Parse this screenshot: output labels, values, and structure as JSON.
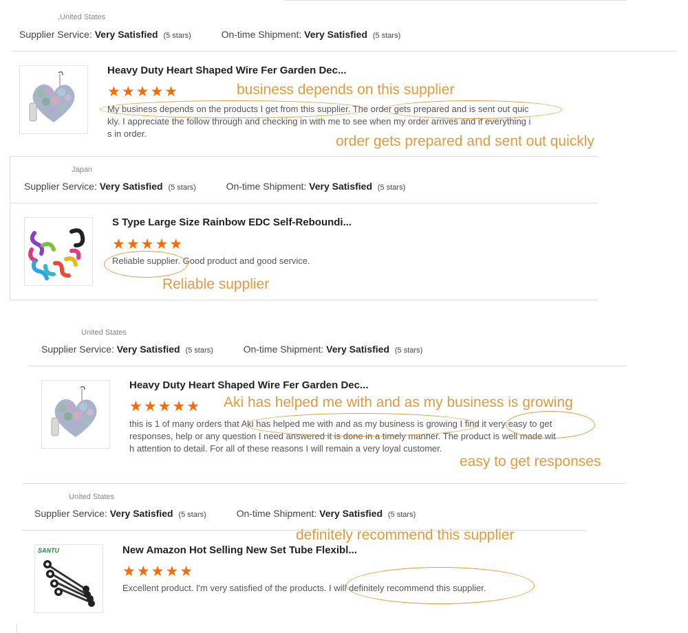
{
  "labels": {
    "supplier_service": "Supplier Service:",
    "ontime_shipment": "On-time Shipment:",
    "satisfied": "Very Satisfied",
    "stars_text": "(5 stars)",
    "stars_glyphs": "★★★★★"
  },
  "reviews": [
    {
      "country": ",United States",
      "product_title": "Heavy Duty Heart Shaped Wire Fer Garden Dec...",
      "review_lines": [
        "My business depends on the products I get from this supplier. The order gets prepared and is sent out quic",
        "kly. I appreciate the follow through and checking in with me to see when my order arrives and if everything i",
        "s in order."
      ],
      "annotations": [
        "business depends on this supplier",
        "order gets prepared and sent out quickly"
      ]
    },
    {
      "country": "Japan",
      "product_title": "S Type Large Size Rainbow EDC Self-Reboundi...",
      "review_lines": [
        "Reliable supplier. Good product and good service."
      ],
      "annotations": [
        "Reliable supplier"
      ]
    },
    {
      "country": "United States",
      "product_title": "Heavy Duty Heart Shaped Wire Fer Garden Dec...",
      "review_lines": [
        "this is 1 of many orders that Aki has helped me with and as my business is growing I find it very easy to get",
        "responses, help or any question I need answered it is done in a timely manner. The product is well made wit",
        "h attention to detail. For all of these reasons I will remain a very loyal customer."
      ],
      "annotations": [
        "Aki has helped me with and as my business is growing",
        "easy to get responses"
      ]
    },
    {
      "country": "United States",
      "product_title": "New Amazon Hot Selling New Set Tube Flexibl...",
      "review_lines": [
        "Excellent product. I'm very satisfied of the products. I will definitely recommend this supplier."
      ],
      "annotations": [
        "definitely recommend this supplier"
      ],
      "brand_logo": "SANTU"
    }
  ],
  "colors": {
    "star": "#ff6a00",
    "annotation": "#e39a3b",
    "divider": "#dddddd"
  }
}
